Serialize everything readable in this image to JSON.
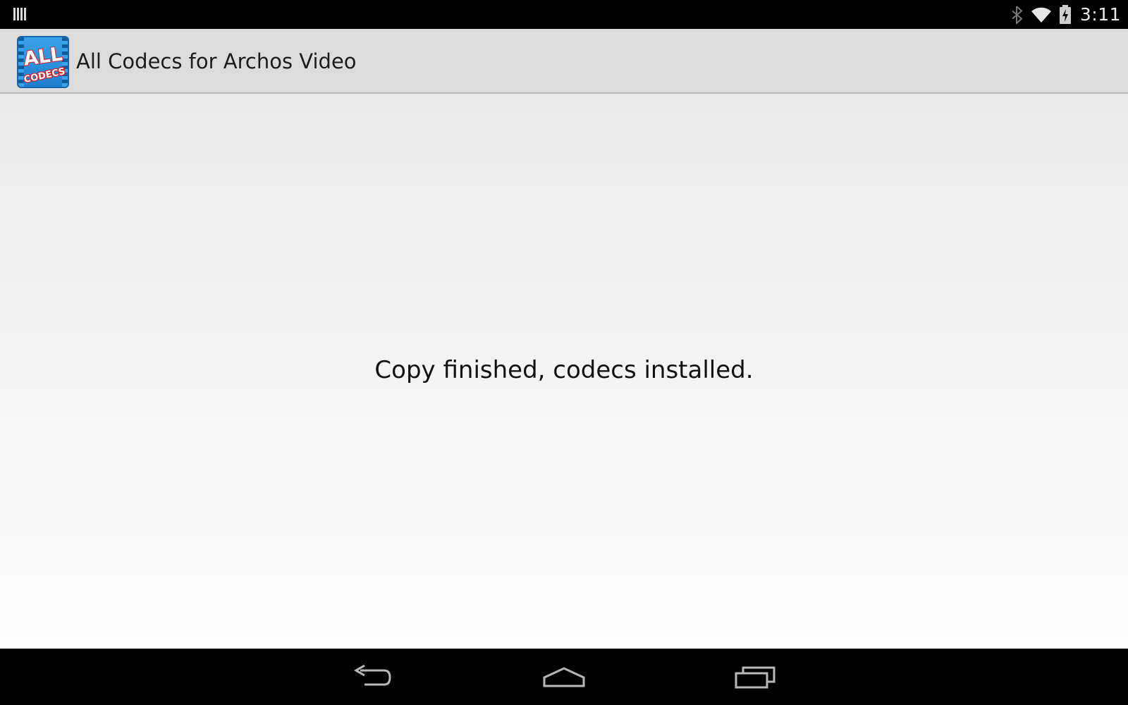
{
  "status_bar": {
    "time": "3:11",
    "icons": [
      "barcode-icon",
      "bluetooth-icon",
      "wifi-icon",
      "battery-charging-icon"
    ]
  },
  "action_bar": {
    "title": "All Codecs for Archos Video",
    "logo": {
      "line1": "ALL",
      "line2": "CODECS"
    }
  },
  "content": {
    "message": "Copy finished, codecs installed."
  },
  "nav_bar": {
    "buttons": [
      "back-icon",
      "home-icon",
      "recent-apps-icon"
    ]
  },
  "colors": {
    "status_bar": "#000000",
    "action_bar": "#dcdcdc",
    "logo_blue": "#2a8fdb",
    "logo_red": "#e0262c"
  }
}
